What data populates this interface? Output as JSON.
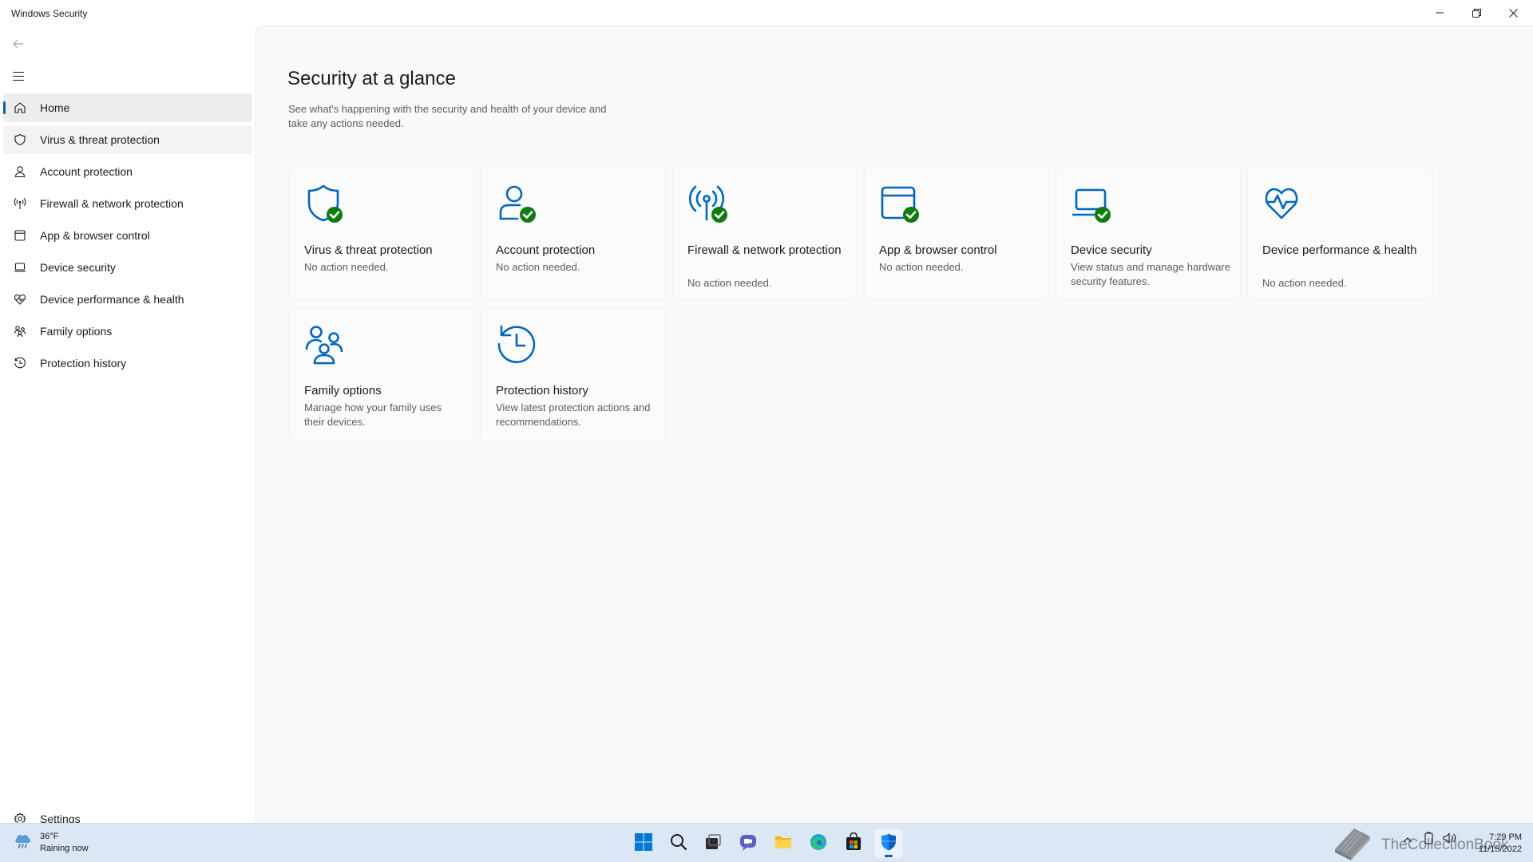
{
  "window": {
    "title": "Windows Security",
    "minimize_icon": "minimize-icon",
    "maximize_icon": "restore-icon",
    "close_icon": "close-icon"
  },
  "sidebar": {
    "back_icon": "back-arrow-icon",
    "menu_icon": "hamburger-menu-icon",
    "items": [
      {
        "label": "Home",
        "icon": "home-icon",
        "selected": true
      },
      {
        "label": "Virus & threat protection",
        "icon": "shield-icon",
        "hover": true
      },
      {
        "label": "Account protection",
        "icon": "person-icon"
      },
      {
        "label": "Firewall & network protection",
        "icon": "antenna-icon"
      },
      {
        "label": "App & browser control",
        "icon": "app-window-icon"
      },
      {
        "label": "Device security",
        "icon": "laptop-icon"
      },
      {
        "label": "Device performance & health",
        "icon": "heart-pulse-icon"
      },
      {
        "label": "Family options",
        "icon": "family-icon"
      },
      {
        "label": "Protection history",
        "icon": "history-icon"
      }
    ],
    "settings": {
      "label": "Settings",
      "icon": "gear-icon"
    }
  },
  "main": {
    "title": "Security at a glance",
    "subtitle": "See what's happening with the security and health of your device and take any actions needed.",
    "cards": [
      {
        "title": "Virus & threat protection",
        "status": "No action needed.",
        "icon": "shield-check-icon",
        "ok": true
      },
      {
        "title": "Account protection",
        "status": "No action needed.",
        "icon": "person-check-icon",
        "ok": true
      },
      {
        "title": "Firewall & network protection",
        "status": "No action needed.",
        "icon": "antenna-check-icon",
        "ok": true
      },
      {
        "title": "App & browser control",
        "status": "No action needed.",
        "icon": "app-window-check-icon",
        "ok": true
      },
      {
        "title": "Device security",
        "status": "View status and manage hardware security features.",
        "icon": "laptop-check-icon",
        "ok": true
      },
      {
        "title": "Device performance & health",
        "status": "No action needed.",
        "icon": "heart-pulse-icon",
        "ok": false
      },
      {
        "title": "Family options",
        "status": "Manage how your family uses their devices.",
        "icon": "family-icon",
        "ok": false
      },
      {
        "title": "Protection history",
        "status": "View latest protection actions and recommendations.",
        "icon": "history-icon",
        "ok": false
      }
    ]
  },
  "taskbar": {
    "weather": {
      "temp": "36°F",
      "condition": "Raining now",
      "icon": "rain-cloud-icon"
    },
    "apps": [
      {
        "name": "start",
        "icon": "windows-logo-icon"
      },
      {
        "name": "search",
        "icon": "search-icon"
      },
      {
        "name": "task-view",
        "icon": "task-view-icon"
      },
      {
        "name": "chat",
        "icon": "chat-icon"
      },
      {
        "name": "file-explorer",
        "icon": "folder-icon"
      },
      {
        "name": "edge",
        "icon": "edge-browser-icon"
      },
      {
        "name": "store",
        "icon": "store-icon"
      },
      {
        "name": "windows-security",
        "icon": "security-shield-icon",
        "active": true
      }
    ],
    "clock": {
      "time": "7:29 PM",
      "date": "11/15/2022"
    },
    "watermark": "TheCollectionBook"
  },
  "colors": {
    "accent": "#005fb8",
    "icon_blue": "#0067c0",
    "ok_green": "#107c10",
    "taskbar": "#dbe7f5"
  }
}
